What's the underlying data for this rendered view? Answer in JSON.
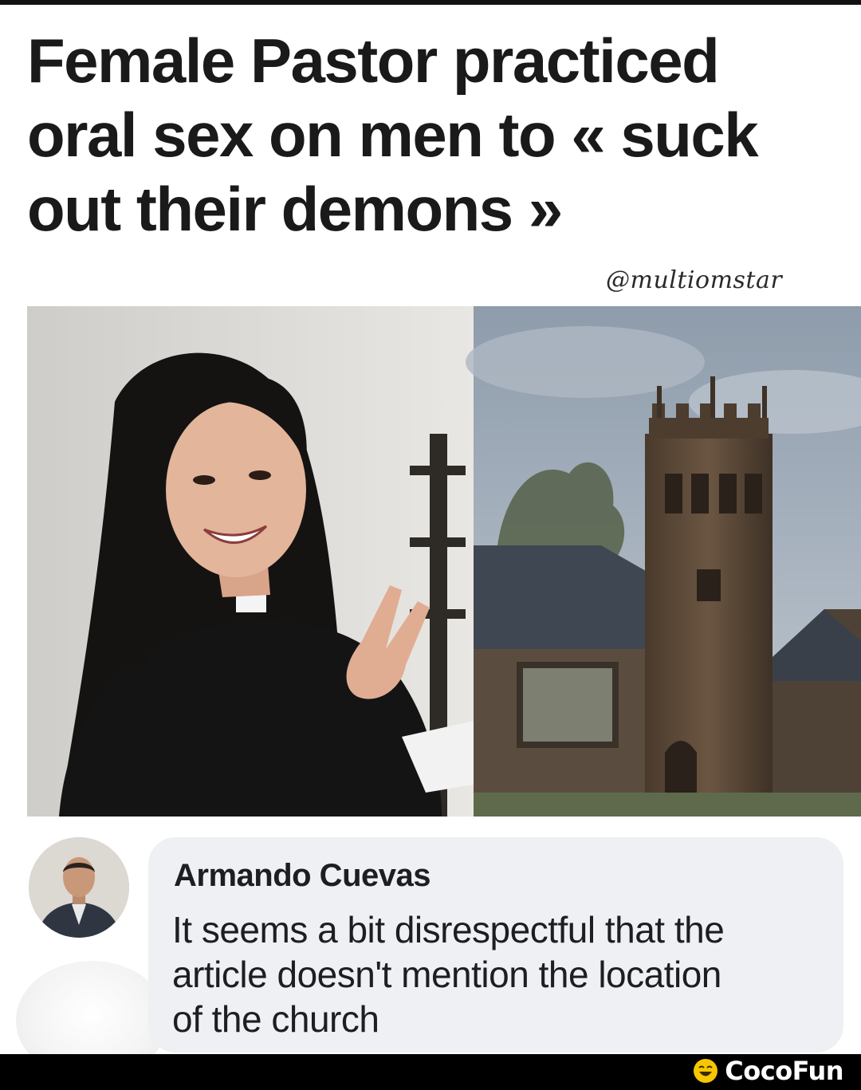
{
  "headline": {
    "lines": [
      "Female Pastor practiced",
      "oral sex on men to « suck",
      "out their demons »"
    ]
  },
  "watermark": "@multiomstar",
  "images": {
    "left": "pastor-photo",
    "right": "church-photo"
  },
  "comment": {
    "author": "Armando Cuevas",
    "text_lines": [
      "It seems a bit disrespectful that the",
      "article doesn't mention the location",
      "of the church"
    ]
  },
  "footer": {
    "brand": "CocoFun",
    "brand_icon": "laughing-face-icon",
    "brand_color": "#f7c600"
  }
}
